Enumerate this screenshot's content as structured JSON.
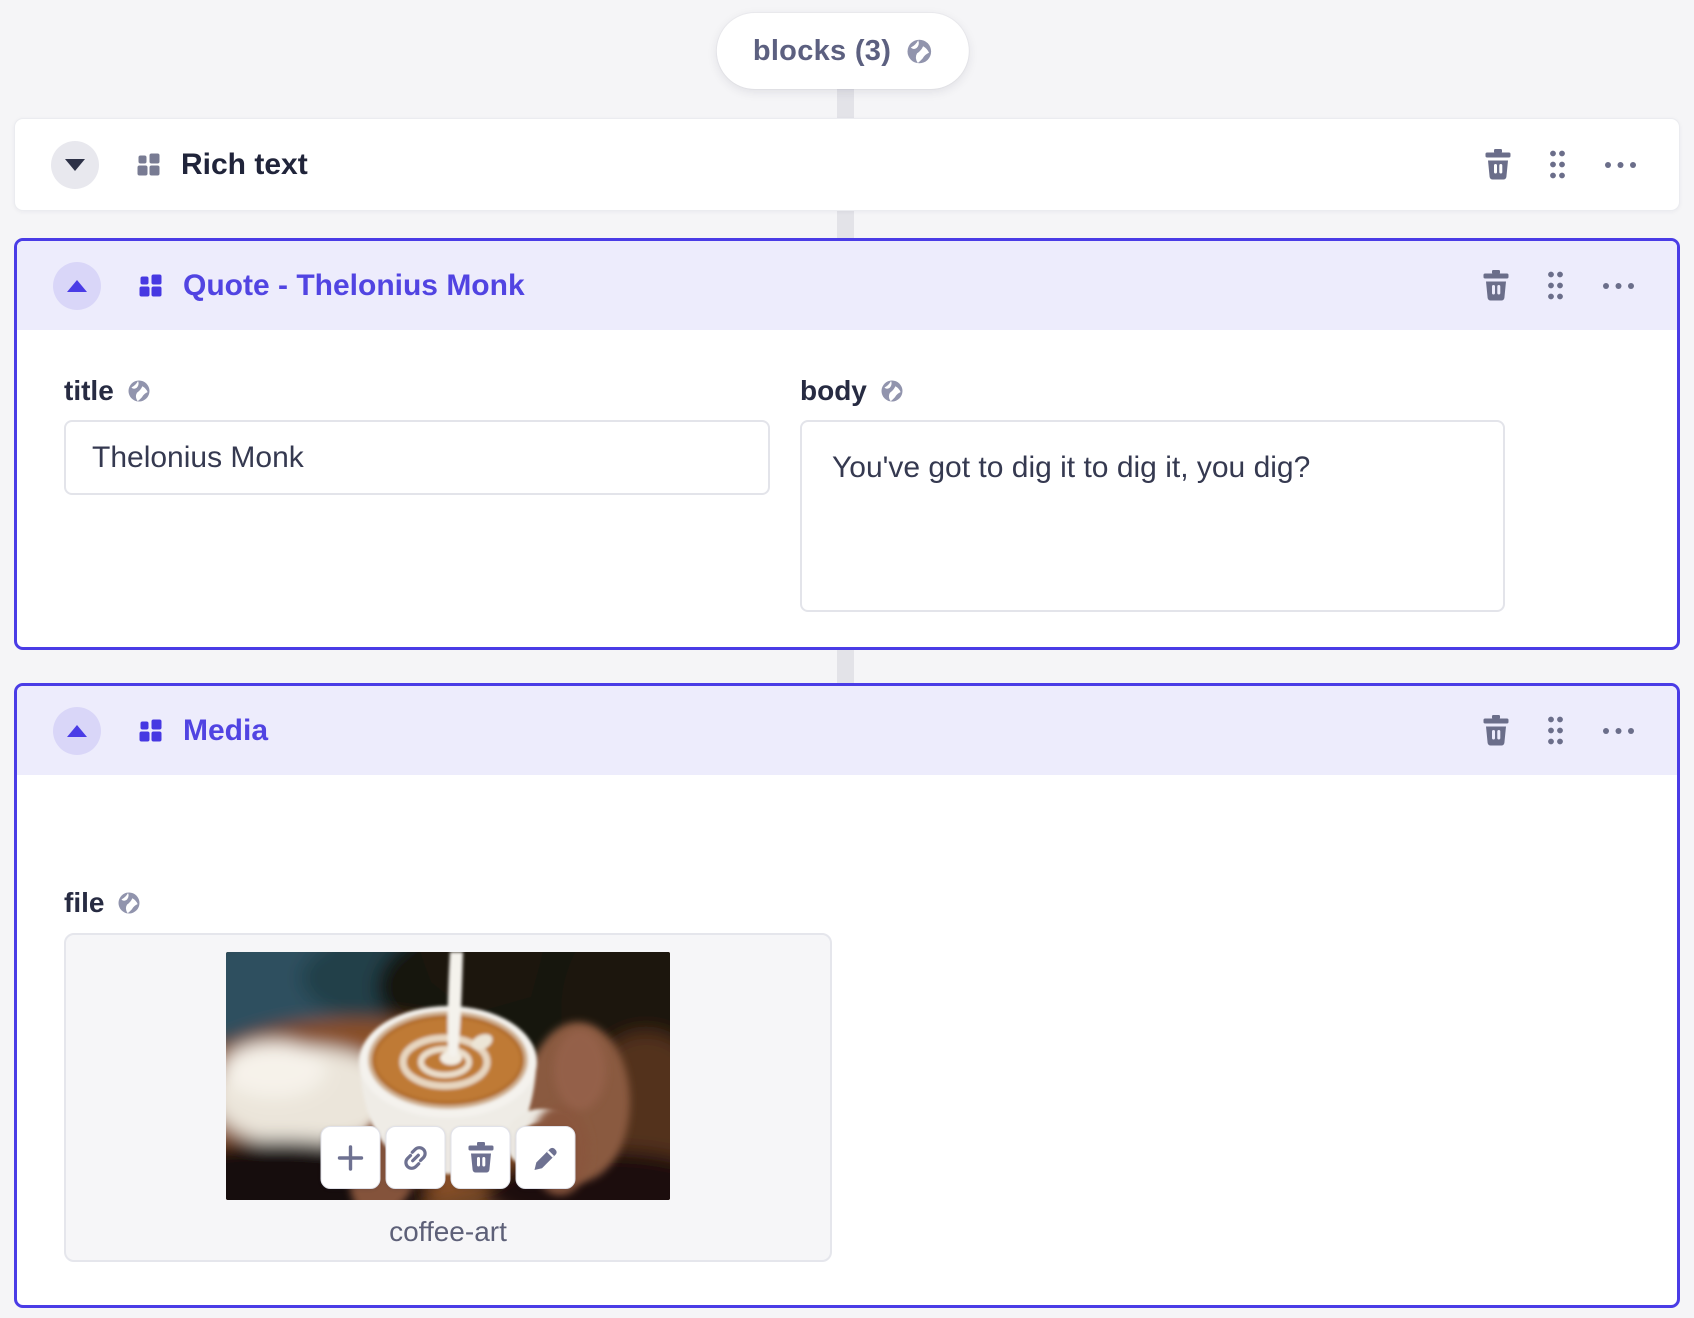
{
  "pill": {
    "label": "blocks (3)"
  },
  "blocks": [
    {
      "title": "Rich text",
      "state": "collapsed",
      "selected": false
    },
    {
      "title": "Quote - Thelonius Monk",
      "state": "expanded",
      "selected": true,
      "fields": {
        "title": {
          "label": "title",
          "value": "Thelonius Monk"
        },
        "body": {
          "label": "body",
          "value": "You've got to dig it to dig it, you dig?"
        }
      }
    },
    {
      "title": "Media",
      "state": "expanded",
      "selected": true,
      "fields": {
        "file": {
          "label": "file",
          "media_caption": "coffee-art"
        }
      }
    }
  ],
  "icons": {
    "pill_globe": "globe-icon",
    "header_actions": [
      "trash-icon",
      "drag-handle-icon",
      "more-options-icon"
    ],
    "media_toolbar": [
      "plus-icon",
      "link-icon",
      "trash-icon",
      "pencil-icon"
    ]
  },
  "colors": {
    "accent": "#4a3ce6",
    "selected_header_bg": "#edecfc",
    "slate_icon": "#6b6e8a",
    "page_bg": "#f5f5f7"
  }
}
